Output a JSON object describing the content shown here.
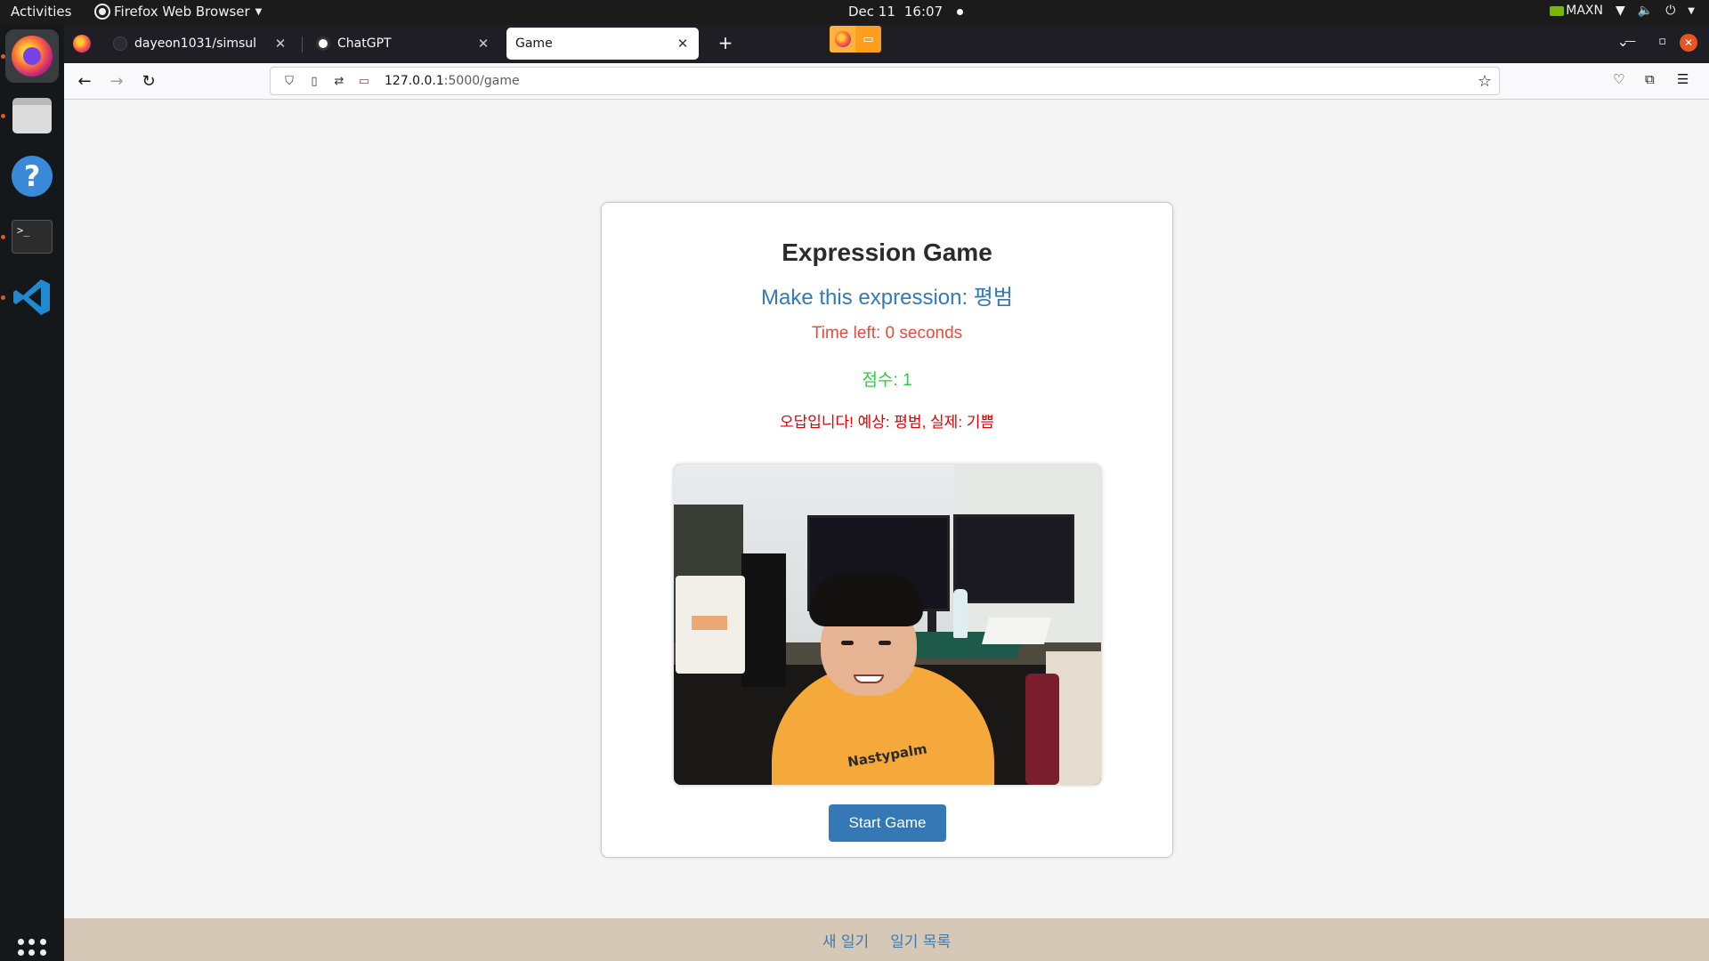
{
  "topbar": {
    "activities": "Activities",
    "app_name": "Firefox Web Browser",
    "date": "Dec 11",
    "time": "16:07",
    "power_mode": "MAXN"
  },
  "tabs": [
    {
      "title": "dayeon1031/simsul",
      "favicon": "github-icon"
    },
    {
      "title": "ChatGPT",
      "favicon": "chatgpt-icon"
    },
    {
      "title": "Game",
      "favicon": "none",
      "selected": true
    }
  ],
  "urlbar": {
    "host": "127.0.0.1",
    "rest": ":5000/game"
  },
  "game": {
    "title": "Expression Game",
    "target_expression": "Make this expression: 평범",
    "time_left": "Time left: 0 seconds",
    "score": "점수: 1",
    "result_message": "오답입니다! 예상: 평범, 실제: 기쁨",
    "start_button": "Start Game",
    "webcam_shirt_text": "Nastypalm"
  },
  "footer": {
    "new_diary": "새 일기",
    "diary_list": "일기 목록"
  },
  "colors": {
    "target_expression": "#337ab7",
    "time_left": "#e74c3c",
    "score": "#2ecc40",
    "result_message": "#e00000",
    "start_button": "#3478b5",
    "footer_bg": "#d6c8b6"
  }
}
